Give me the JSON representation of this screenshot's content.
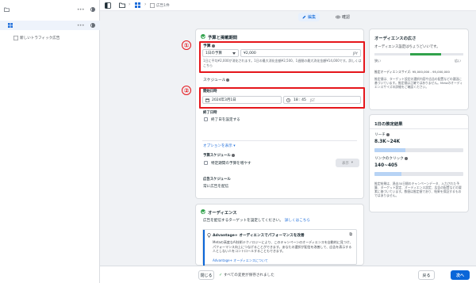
{
  "sidebar": {
    "items": [
      {
        "label": "",
        "icon": "folder-icon"
      },
      {
        "label": "",
        "icon": "grid-icon"
      },
      {
        "label": "新しいトラフィック広告",
        "icon": "ad-icon"
      }
    ]
  },
  "topbar": {
    "breadcrumb": "広告1件",
    "icons": [
      "panel-toggle-icon",
      "folder-icon",
      "grid-icon",
      "ad-icon"
    ]
  },
  "tabs": {
    "edit": "編集",
    "review": "確認"
  },
  "budget_card": {
    "title": "予算と掲載期間",
    "budget_label": "予算",
    "budget_type": "1日の予算",
    "budget_amount": "¥2,000",
    "budget_currency": "JPY",
    "budget_help": "1日に平均¥2,000が消化されます。1日の最大消化金額¥2,500、1週間の最大消化金額¥14,000です。詳しくはこちら",
    "schedule_label": "スケジュール",
    "start_label": "開始日時",
    "start_date": "2024年3月1日",
    "start_time": "18 : 45",
    "start_tz": "JST",
    "end_label": "終了日時",
    "end_checkbox_label": "終了日を設定する",
    "show_more_link": "オプションを表示",
    "budget_schedule_label": "予算スケジュール",
    "budget_schedule_checkbox": "特定期間の予算を増やす",
    "budget_schedule_button": "表示",
    "ad_schedule_label": "広告スケジュール",
    "ad_schedule_value": "常に広告を配信"
  },
  "audience_card": {
    "title": "オーディエンス",
    "desc": "広告を配信するターゲットを設定してください。",
    "desc_link": "詳しくはこちら",
    "advantage_title": "Advantage+ オーディエンスでパフォーマンスを改善",
    "advantage_body": "Metaの高度なAI技術テクノロジーにより、このキャンペーンのオーディエンスを自動的に見つけ、パフォーマンス向上につなげることができます。あなたの選択が配信を改善して、広告を表示する人としない人をコントロールすることもできます。",
    "advantage_link": "Advantage+ オーディエンスについて"
  },
  "annotations": {
    "one": "①",
    "two": "②"
  },
  "audience_size_card": {
    "title": "オーディエンスの広さ",
    "status": "オーディエンス設定はちょうどいいです。",
    "low": "狭い",
    "high": "広い",
    "level_fraction": 0.62,
    "estimate_label": "推定オーディエンスサイズ: 95,000,000 - 95,000,000",
    "estimate_note": "推定値は、ターゲット設定の選択内容や広告の配置などの要因に基づいています。推定値は正確ではありません。Metaのオーディエンスサイズの詳細をご確認ください。"
  },
  "daily_results_card": {
    "title": "1日の推定結果",
    "reach_label": "リーチ",
    "reach_value": "8.3K~24K",
    "reach_fraction": 0.35,
    "clicks_label": "リンクのクリック",
    "clicks_value": "140~405",
    "clicks_fraction": 0.3,
    "note": "推定結果は、過去30日間のキャンペーンデータ、入力された予算、ターゲット設定、オーディエンス設定、広告の配置などの要素に基づいています。数値は推定値であり、結果を保証するものではありません。"
  },
  "footer": {
    "close_button": "閉じる",
    "save_status": "すべての変更が保存されました",
    "back_button": "戻る",
    "next_button": "次へ"
  },
  "colors": {
    "accent": "#0a66d8",
    "highlight": "#e5161b",
    "success": "#31a24c"
  }
}
